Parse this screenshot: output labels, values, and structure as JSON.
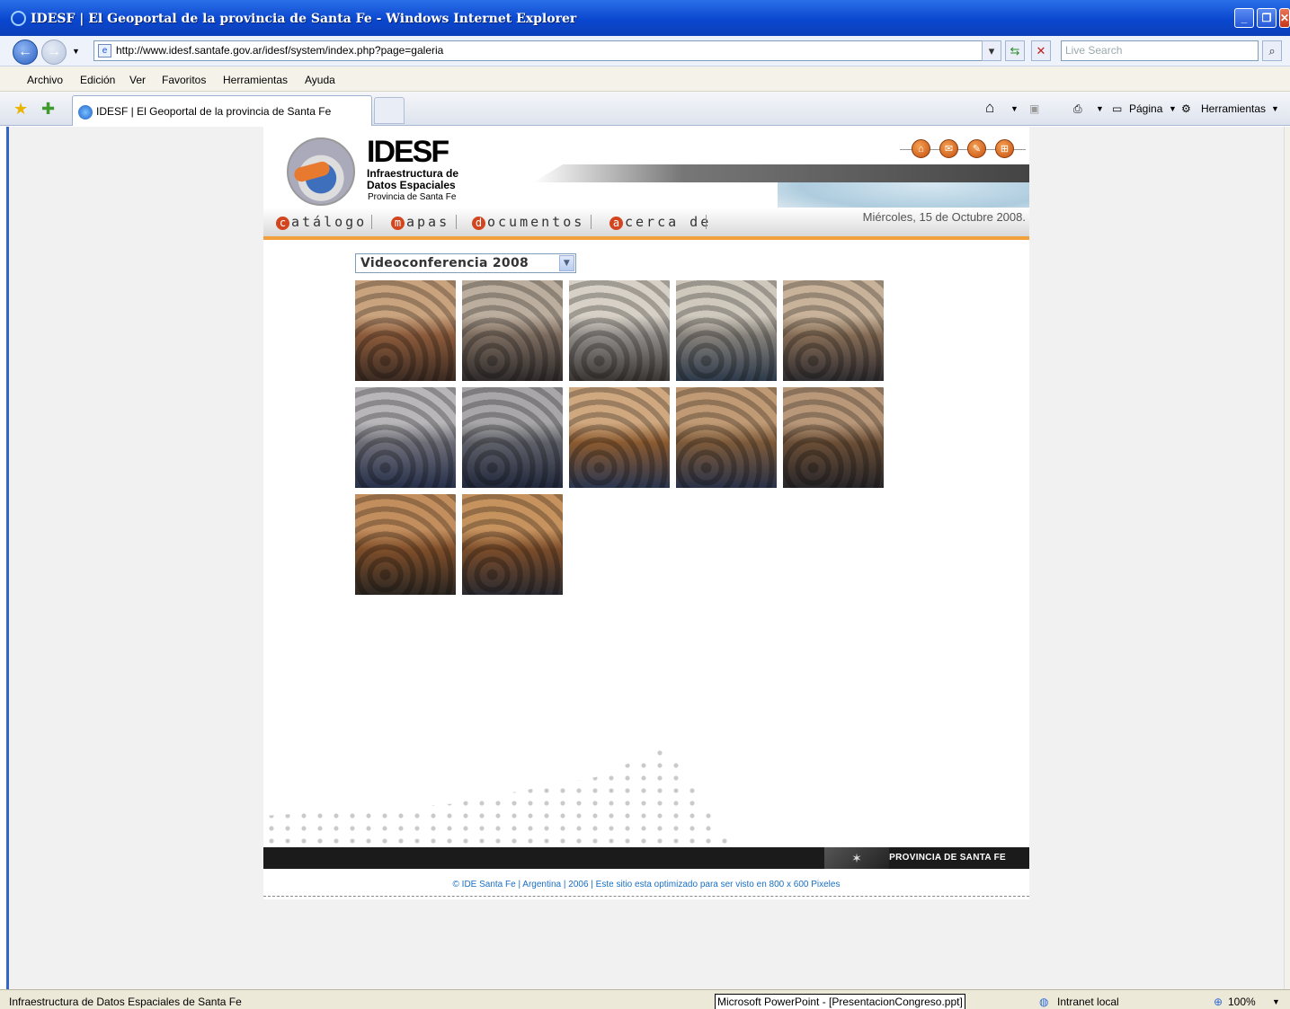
{
  "window": {
    "title": "IDESF  |  El Geoportal de la provincia de Santa Fe - Windows Internet Explorer"
  },
  "browser": {
    "url": "http://www.idesf.santafe.gov.ar/idesf/system/index.php?page=galeria",
    "search_placeholder": "Live Search",
    "menu": [
      "Archivo",
      "Edición",
      "Ver",
      "Favoritos",
      "Herramientas",
      "Ayuda"
    ],
    "tab_title": "IDESF | El Geoportal de la provincia de Santa Fe",
    "cmd_page": "Página",
    "cmd_tools": "Herramientas"
  },
  "site": {
    "logo_title": "IDESF",
    "logo_sub1": "Infraestructura de",
    "logo_sub2": "Datos Espaciales",
    "logo_sub3": "Provincia de Santa Fe",
    "nav": [
      {
        "initial": "c",
        "rest": "atálogo"
      },
      {
        "initial": "m",
        "rest": "apas"
      },
      {
        "initial": "d",
        "rest": "ocumentos"
      },
      {
        "initial": "a",
        "rest": "cerca de"
      }
    ],
    "date": "Miércoles, 15 de Octubre 2008.",
    "album_selected": "Videoconferencia 2008",
    "thumb_count": 12,
    "footer_province": "PROVINCIA DE SANTA FE",
    "copyright": "© IDE Santa Fe | Argentina | 2006 | Este sitio esta optimizado para ser visto en 800 x 600 Pixeles"
  },
  "status": {
    "text": "Infraestructura de Datos Espaciales de Santa Fe",
    "taskbar_item": "Microsoft PowerPoint - [PresentacionCongreso.ppt]",
    "zone": "Intranet local",
    "zoom": "100%"
  },
  "colors": {
    "accent_orange": "#f2a03c",
    "xp_blue": "#0a47cf",
    "nav_bullet": "#d2451e",
    "link": "#1a6fc4"
  }
}
